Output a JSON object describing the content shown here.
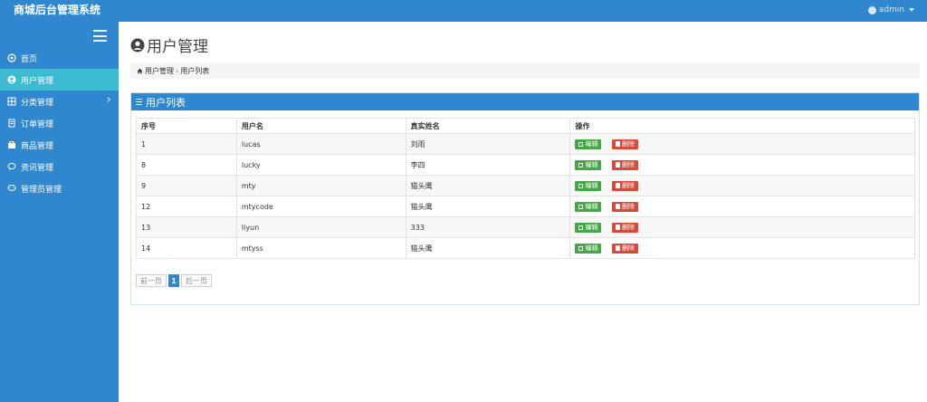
{
  "header": {
    "brand": "商城后台管理系统",
    "user": "admin"
  },
  "sidebar": {
    "items": [
      {
        "label": "首页",
        "icon": "home-icon"
      },
      {
        "label": "用户管理",
        "icon": "user-icon"
      },
      {
        "label": "分类管理",
        "icon": "category-icon"
      },
      {
        "label": "订单管理",
        "icon": "order-icon"
      },
      {
        "label": "商品管理",
        "icon": "product-icon"
      },
      {
        "label": "资讯管理",
        "icon": "news-icon"
      },
      {
        "label": "管理员管理",
        "icon": "admin-icon"
      }
    ]
  },
  "main": {
    "title": "用户管理",
    "breadcrumb": {
      "first": "用户管理",
      "separator": "›",
      "second": "用户列表"
    },
    "panel_title": "用户列表",
    "table": {
      "headers": [
        "序号",
        "用户名",
        "真实姓名",
        "操作"
      ],
      "rows": [
        {
          "id": "1",
          "username": "lucas",
          "realname": "刘雨"
        },
        {
          "id": "8",
          "username": "lucky",
          "realname": "李四"
        },
        {
          "id": "9",
          "username": "mty",
          "realname": "猫头鹰"
        },
        {
          "id": "12",
          "username": "mtycode",
          "realname": "猫头鹰"
        },
        {
          "id": "13",
          "username": "liyun",
          "realname": "333"
        },
        {
          "id": "14",
          "username": "mtyss",
          "realname": "猫头鹰"
        }
      ],
      "edit_label": "编辑",
      "delete_label": "删除"
    },
    "pagination": {
      "prev": "前一页",
      "current": "1",
      "next": "后一页"
    }
  },
  "colors": {
    "primary": "#2e87cf",
    "active": "#3cbcd3",
    "edit": "#45a746",
    "delete": "#d64a3a"
  }
}
